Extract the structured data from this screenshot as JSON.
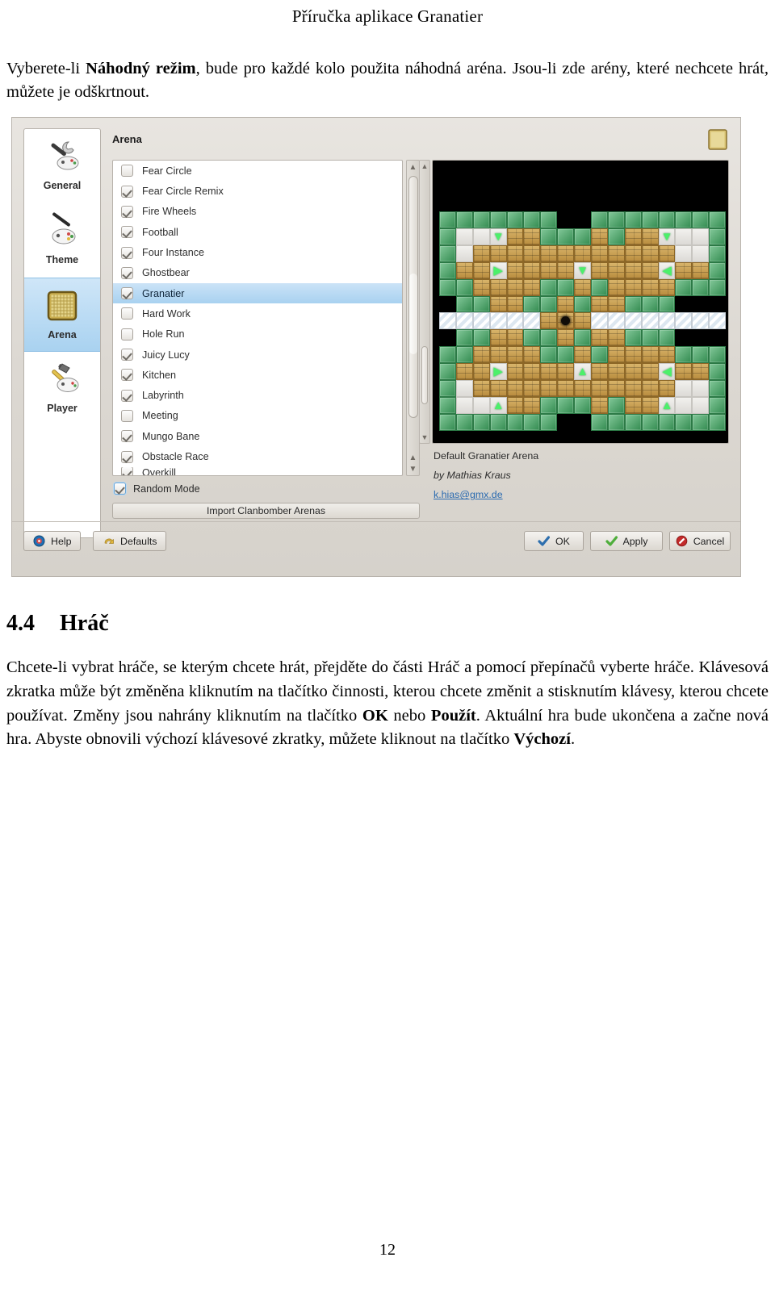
{
  "document": {
    "running_head": "Příručka aplikace Granatier",
    "intro_paragraph_html": "Vyberete-li <b>Náhodný režim</b>, bude pro každé kolo použita náhodná aréna. Jsou-li zde arény, které nechcete hrát, můžete je odškrtnout.",
    "section": {
      "number": "4.4",
      "title": "Hráč"
    },
    "body_paragraph_html": "Chcete-li vybrat hráče, se kterým chcete hrát, přejděte do části Hráč a pomocí přepínačů vyberte hráče. Klávesová zkratka může být změněna kliknutím na tlačítko činnosti, kterou chcete změnit a stisknutím klávesy, kterou chcete používat. Změny jsou nahrány kliknutím na tlačítko <b>OK</b> nebo <b>Použít</b>. Aktuální hra bude ukončena a začne nová hra. Abyste obnovili výchozí klávesové zkratky, můžete kliknout na tlačítko <b>Výchozí</b>.",
    "page_number": "12"
  },
  "screenshot": {
    "header": {
      "title": "Arena",
      "icon": "arena-grid-icon"
    },
    "sidebar": {
      "items": [
        {
          "label": "General",
          "icon": "wrench-gamepad-icon",
          "selected": false
        },
        {
          "label": "Theme",
          "icon": "brush-gamepad-icon",
          "selected": false
        },
        {
          "label": "Arena",
          "icon": "arena-grid-icon",
          "selected": true
        },
        {
          "label": "Player",
          "icon": "hammer-gamepad-icon",
          "selected": false
        }
      ]
    },
    "arena_list": {
      "items": [
        {
          "label": "Fear Circle",
          "checked": false,
          "selected": false
        },
        {
          "label": "Fear Circle Remix",
          "checked": true,
          "selected": false
        },
        {
          "label": "Fire Wheels",
          "checked": true,
          "selected": false
        },
        {
          "label": "Football",
          "checked": true,
          "selected": false
        },
        {
          "label": "Four Instance",
          "checked": true,
          "selected": false
        },
        {
          "label": "Ghostbear",
          "checked": true,
          "selected": false
        },
        {
          "label": "Granatier",
          "checked": true,
          "selected": true
        },
        {
          "label": "Hard Work",
          "checked": false,
          "selected": false
        },
        {
          "label": "Hole Run",
          "checked": false,
          "selected": false
        },
        {
          "label": "Juicy Lucy",
          "checked": true,
          "selected": false
        },
        {
          "label": "Kitchen",
          "checked": true,
          "selected": false
        },
        {
          "label": "Labyrinth",
          "checked": true,
          "selected": false
        },
        {
          "label": "Meeting",
          "checked": false,
          "selected": false
        },
        {
          "label": "Mungo Bane",
          "checked": true,
          "selected": false
        },
        {
          "label": "Obstacle Race",
          "checked": true,
          "selected": false
        },
        {
          "label": "Overkill",
          "checked": true,
          "selected": false
        }
      ]
    },
    "random_mode": {
      "label": "Random Mode",
      "checked": true
    },
    "import_button": {
      "label": "Import Clanbomber Arenas"
    },
    "preview_meta": {
      "name": "Default Granatier Arena",
      "author": "by Mathias Kraus",
      "email": "k.hias@gmx.de"
    },
    "bottom_buttons": {
      "left": [
        {
          "label": "Help",
          "icon": "help-icon"
        },
        {
          "label": "Defaults",
          "icon": "undo-arrow-icon"
        }
      ],
      "right": [
        {
          "label": "OK",
          "icon": "blue-check-icon"
        },
        {
          "label": "Apply",
          "icon": "green-check-icon"
        },
        {
          "label": "Cancel",
          "icon": "red-cancel-icon"
        }
      ]
    },
    "colors": {
      "dialog_bg": "#dedad4",
      "selection_blue": "#a8d1f0",
      "link_blue": "#2a6ab0",
      "arena_green": "#3faa62",
      "arena_brick": "#b98c3e",
      "arrow_green": "#4cf06a"
    },
    "arena_preview": {
      "name": "Default Granatier Arena",
      "cols": 17,
      "rows": 13,
      "legend": {
        "e": "empty-black",
        "g": "green-block",
        "b": "brick-block",
        "f": "floor",
        "i": "ice-floor",
        "^": "floor-arrow-up",
        "v": "floor-arrow-down",
        "<": "floor-arrow-left",
        ">": "floor-arrow-right",
        "o": "hole"
      },
      "map": [
        "gggggggeegggggggg",
        "gff v bb g g b g b b v ff g",
        "gf bbbbbbbbbbbb f g",
        "gbb > bbbbb v bbbb < bb g",
        "g g bbbb g g b g bbbb g g",
        "eegg bb gg bb g g bb g ee",
        "iiiiii b o b iiiiiii",
        "eegg bb gg b gg bb g ee",
        "g g bbbb g g b g bbbb g g",
        "gbb > bbbbb ^ bbbb < bb g",
        "gf bbbbbbbbbbbb f g",
        "gff ^ bb g g b g b b ^ ff g",
        "gggggggeegggggggg"
      ]
    }
  }
}
